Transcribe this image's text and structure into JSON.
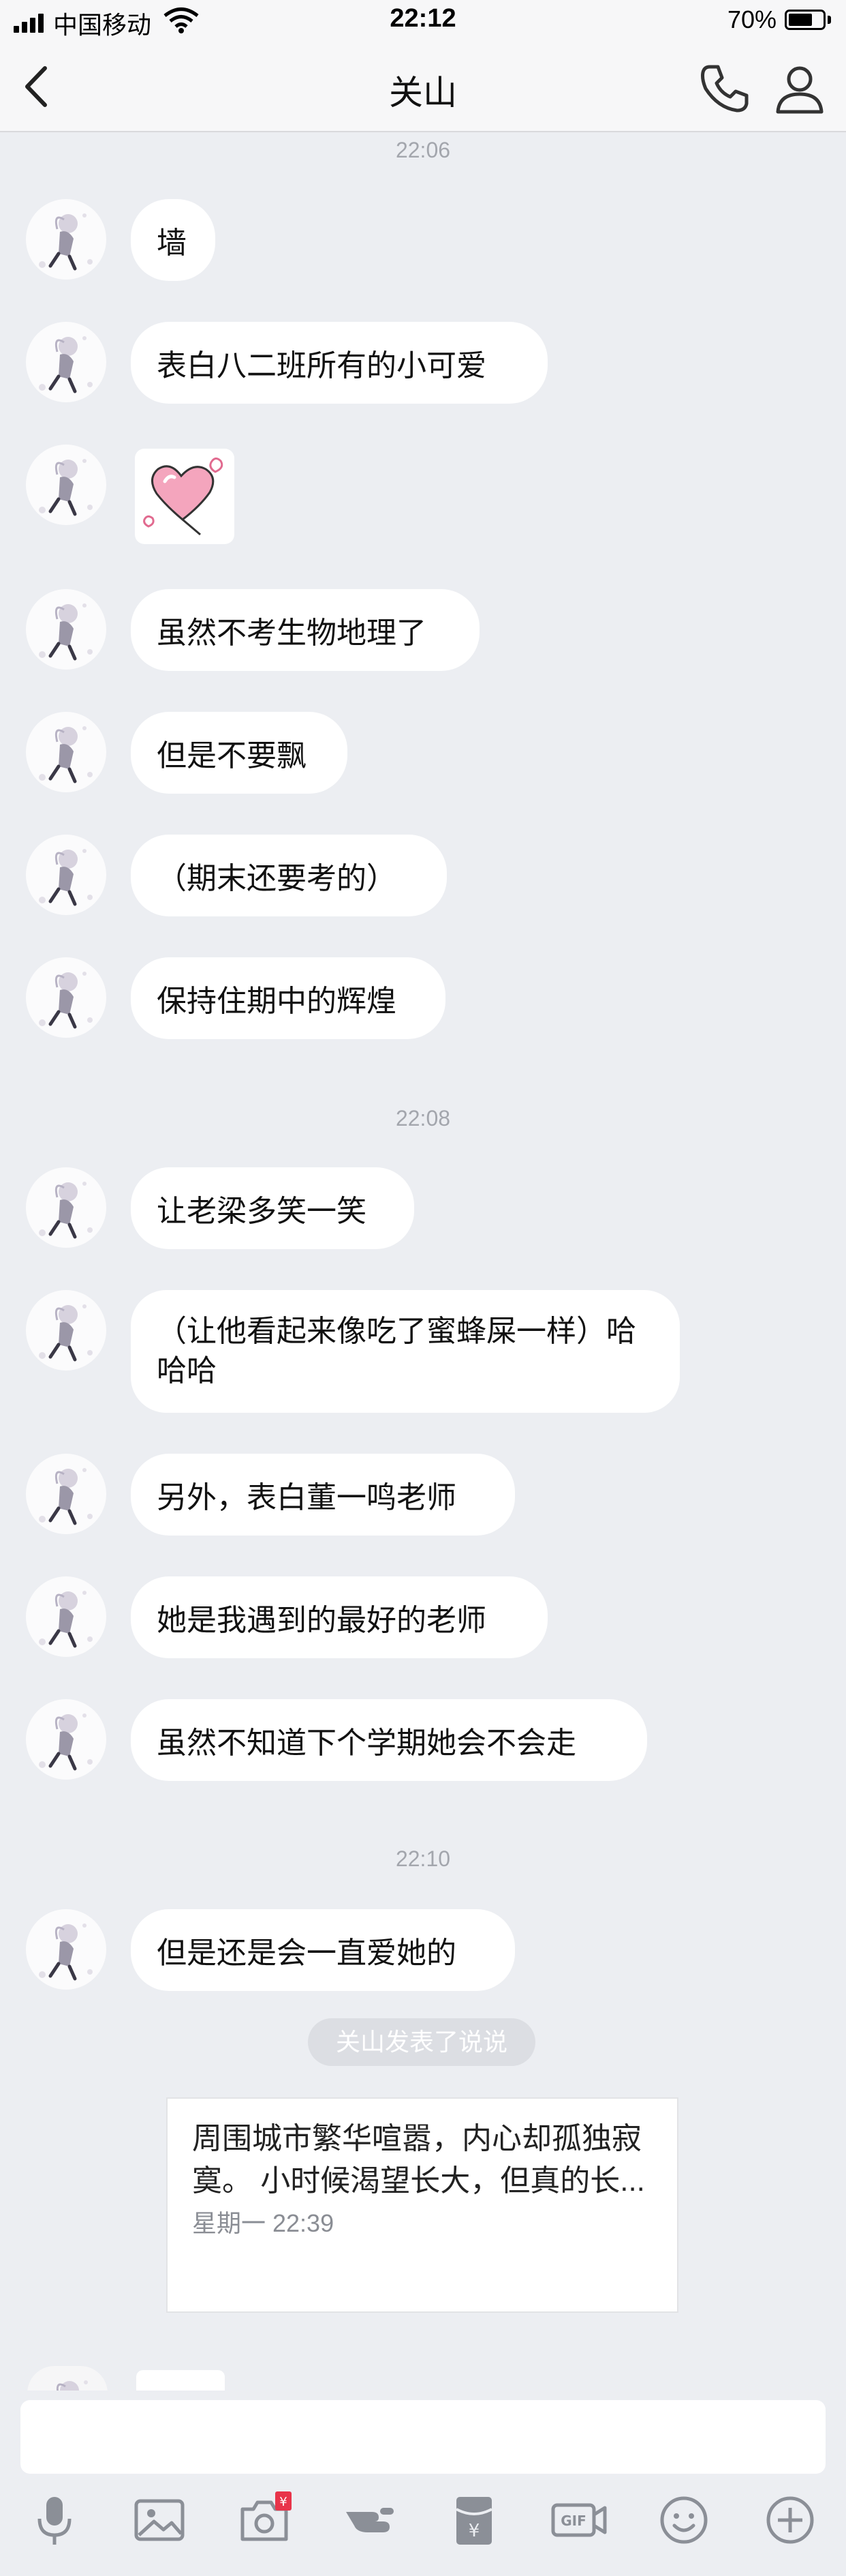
{
  "status_bar": {
    "carrier": "中国移动",
    "time": "22:12",
    "battery": "70%",
    "battery_level": 0.7
  },
  "header": {
    "title": "关山",
    "icons": [
      "back-icon",
      "phone-icon",
      "profile-icon"
    ]
  },
  "chat": {
    "timestamps": [
      "22:06",
      "22:08",
      "22:10"
    ],
    "messages": [
      {
        "text": "墙"
      },
      {
        "text": "表白八二班所有的小可爱"
      },
      {
        "text": "",
        "type": "sticker",
        "icon": "heart-sticker"
      },
      {
        "text": "虽然不考生物地理了"
      },
      {
        "text": "但是不要飘"
      },
      {
        "text": "（期末还要考的）"
      },
      {
        "text": "保持住期中的辉煌"
      },
      {
        "text": "让老梁多笑一笑"
      },
      {
        "text": "（让他看起来像吃了蜜蜂屎一样）哈哈哈"
      },
      {
        "text": "另外，表白董一鸣老师"
      },
      {
        "text": "她是我遇到的最好的老师"
      },
      {
        "text": "虽然不知道下个学期她会不会走"
      },
      {
        "text": "但是还是会一直爱她的"
      }
    ],
    "system_notice": "关山发表了说说",
    "share_card": {
      "text": "周围城市繁华喧嚣，内心却孤独寂寞。 小时候渴望长大，但真的长...",
      "time": "星期一 22:39"
    }
  },
  "input": {
    "placeholder": "",
    "toolbar": [
      {
        "icon": "microphone-icon"
      },
      {
        "icon": "image-icon"
      },
      {
        "icon": "camera-icon",
        "badge": "¥"
      },
      {
        "icon": "poke-icon"
      },
      {
        "icon": "red-packet-icon"
      },
      {
        "icon": "gif-icon",
        "label": "GIF"
      },
      {
        "icon": "emoji-icon"
      },
      {
        "icon": "plus-icon"
      }
    ]
  },
  "colors": {
    "background": "#eceef2",
    "bubble": "#ffffff",
    "timestamp": "#a3a6ad",
    "icon": "#8b8f97",
    "badge": "#e8344a"
  }
}
